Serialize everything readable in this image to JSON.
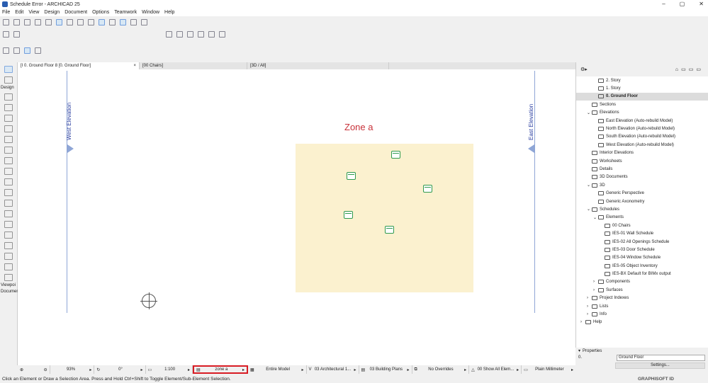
{
  "window": {
    "title": "Schedule Error - ARCHICAD 25",
    "controls": [
      "–",
      "▢",
      "✕"
    ]
  },
  "menu": [
    "File",
    "Edit",
    "View",
    "Design",
    "Document",
    "Options",
    "Teamwork",
    "Window",
    "Help"
  ],
  "tabs": [
    {
      "label": "[I 0. Ground Floor 8 [0. Ground Floor]",
      "close": "×"
    },
    {
      "label": "[00 Chairs]"
    },
    {
      "label": "[3D / All]"
    }
  ],
  "toolbox": {
    "select_label": "Design",
    "viewpoint_label": "Viewpoi",
    "document_label": "Documen"
  },
  "canvas": {
    "west_elevation": "West Elevation",
    "east_elevation": "East Elevation",
    "zone_label": "Zone a",
    "accent_zone": "#fbf1cf",
    "accent_text": "#c8323a"
  },
  "status": {
    "zoom": "93%",
    "angle": "0°",
    "scale": "1:100",
    "zone": "zone a",
    "model": "Entire Model",
    "layer": "03 Architectural 1...",
    "pen": "03 Building Plans",
    "overrides": "No Overrides",
    "renovation": "00 Show All Elem...",
    "dimension": "Plain Millimeter"
  },
  "message": "Click an Element or Draw a Selection Area. Press and Hold Ctrl+Shift to Toggle Element/Sub-Element Selection.",
  "navigator": {
    "items": [
      {
        "label": "2. Story",
        "level": 2
      },
      {
        "label": "1. Story",
        "level": 2
      },
      {
        "label": "0. Ground Floor",
        "level": 2,
        "selected": true
      },
      {
        "label": "Sections",
        "level": 1
      },
      {
        "label": "Elevations",
        "level": 1,
        "expanded": true
      },
      {
        "label": "East Elevation (Auto-rebuild Model)",
        "level": 2
      },
      {
        "label": "North Elevation (Auto-rebuild Model)",
        "level": 2
      },
      {
        "label": "South Elevation (Auto-rebuild Model)",
        "level": 2
      },
      {
        "label": "West Elevation (Auto-rebuild Model)",
        "level": 2
      },
      {
        "label": "Interior Elevations",
        "level": 1
      },
      {
        "label": "Worksheets",
        "level": 1
      },
      {
        "label": "Details",
        "level": 1
      },
      {
        "label": "3D Documents",
        "level": 1
      },
      {
        "label": "3D",
        "level": 1,
        "expanded": true
      },
      {
        "label": "Generic Perspective",
        "level": 2
      },
      {
        "label": "Generic Axonometry",
        "level": 2
      },
      {
        "label": "Schedules",
        "level": 1,
        "expanded": true
      },
      {
        "label": "Elements",
        "level": 2,
        "expanded": true
      },
      {
        "label": "00 Chairs",
        "level": 3
      },
      {
        "label": "IES-01 Wall Schedule",
        "level": 3
      },
      {
        "label": "IES-02 All Openings Schedule",
        "level": 3
      },
      {
        "label": "IES-03 Door Schedule",
        "level": 3
      },
      {
        "label": "IES-04 Window Schedule",
        "level": 3
      },
      {
        "label": "IES-05 Object Inventory",
        "level": 3
      },
      {
        "label": "IES-BX Default for BIMx output",
        "level": 3
      },
      {
        "label": "Components",
        "level": 2,
        "collapsed": true
      },
      {
        "label": "Surfaces",
        "level": 2,
        "collapsed": true
      },
      {
        "label": "Project Indexes",
        "level": 1,
        "collapsed": true
      },
      {
        "label": "Lists",
        "level": 1,
        "collapsed": true
      },
      {
        "label": "Info",
        "level": 1,
        "collapsed": true
      },
      {
        "label": "Help",
        "level": 0,
        "collapsed": true
      }
    ]
  },
  "properties": {
    "title": "Properties",
    "id": "0.",
    "name": "Ground Floor",
    "settings": "Settings..."
  },
  "brand": "GRAPHISOFT ID"
}
